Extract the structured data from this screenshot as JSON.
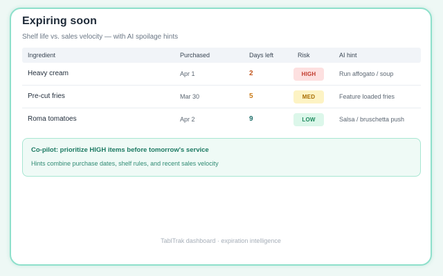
{
  "card": {
    "title": "Expiring soon",
    "subtitle": "Shelf life vs. sales velocity — with AI spoilage hints"
  },
  "table": {
    "columns": [
      "Ingredient",
      "Purchased",
      "Days left",
      "Risk",
      "AI hint"
    ],
    "rows": [
      {
        "ingredient": "Heavy cream",
        "purchased": "Apr 1",
        "days_left": "2",
        "risk": "HIGH",
        "hint": "Run affogato / soup"
      },
      {
        "ingredient": "Pre-cut fries",
        "purchased": "Mar 30",
        "days_left": "5",
        "risk": "MED",
        "hint": "Feature loaded fries"
      },
      {
        "ingredient": "Roma tomatoes",
        "purchased": "Apr 2",
        "days_left": "9",
        "risk": "LOW",
        "hint": "Salsa / bruschetta push"
      }
    ]
  },
  "risk_colors": {
    "HIGH": {
      "bg": "#fde0e0",
      "fg": "#c0392b",
      "days": "#c2561e"
    },
    "MED": {
      "bg": "#fdf3c4",
      "fg": "#a86c00",
      "days": "#c97a16"
    },
    "LOW": {
      "bg": "#dcf7ea",
      "fg": "#1f8a5e",
      "days": "#1e6f6a"
    }
  },
  "callout": {
    "title": "Co-pilot: prioritize HIGH items before tomorrow's service",
    "text": "Hints combine purchase dates, shelf rules, and recent sales velocity"
  },
  "footer": "TablTrak dashboard · expiration intelligence"
}
